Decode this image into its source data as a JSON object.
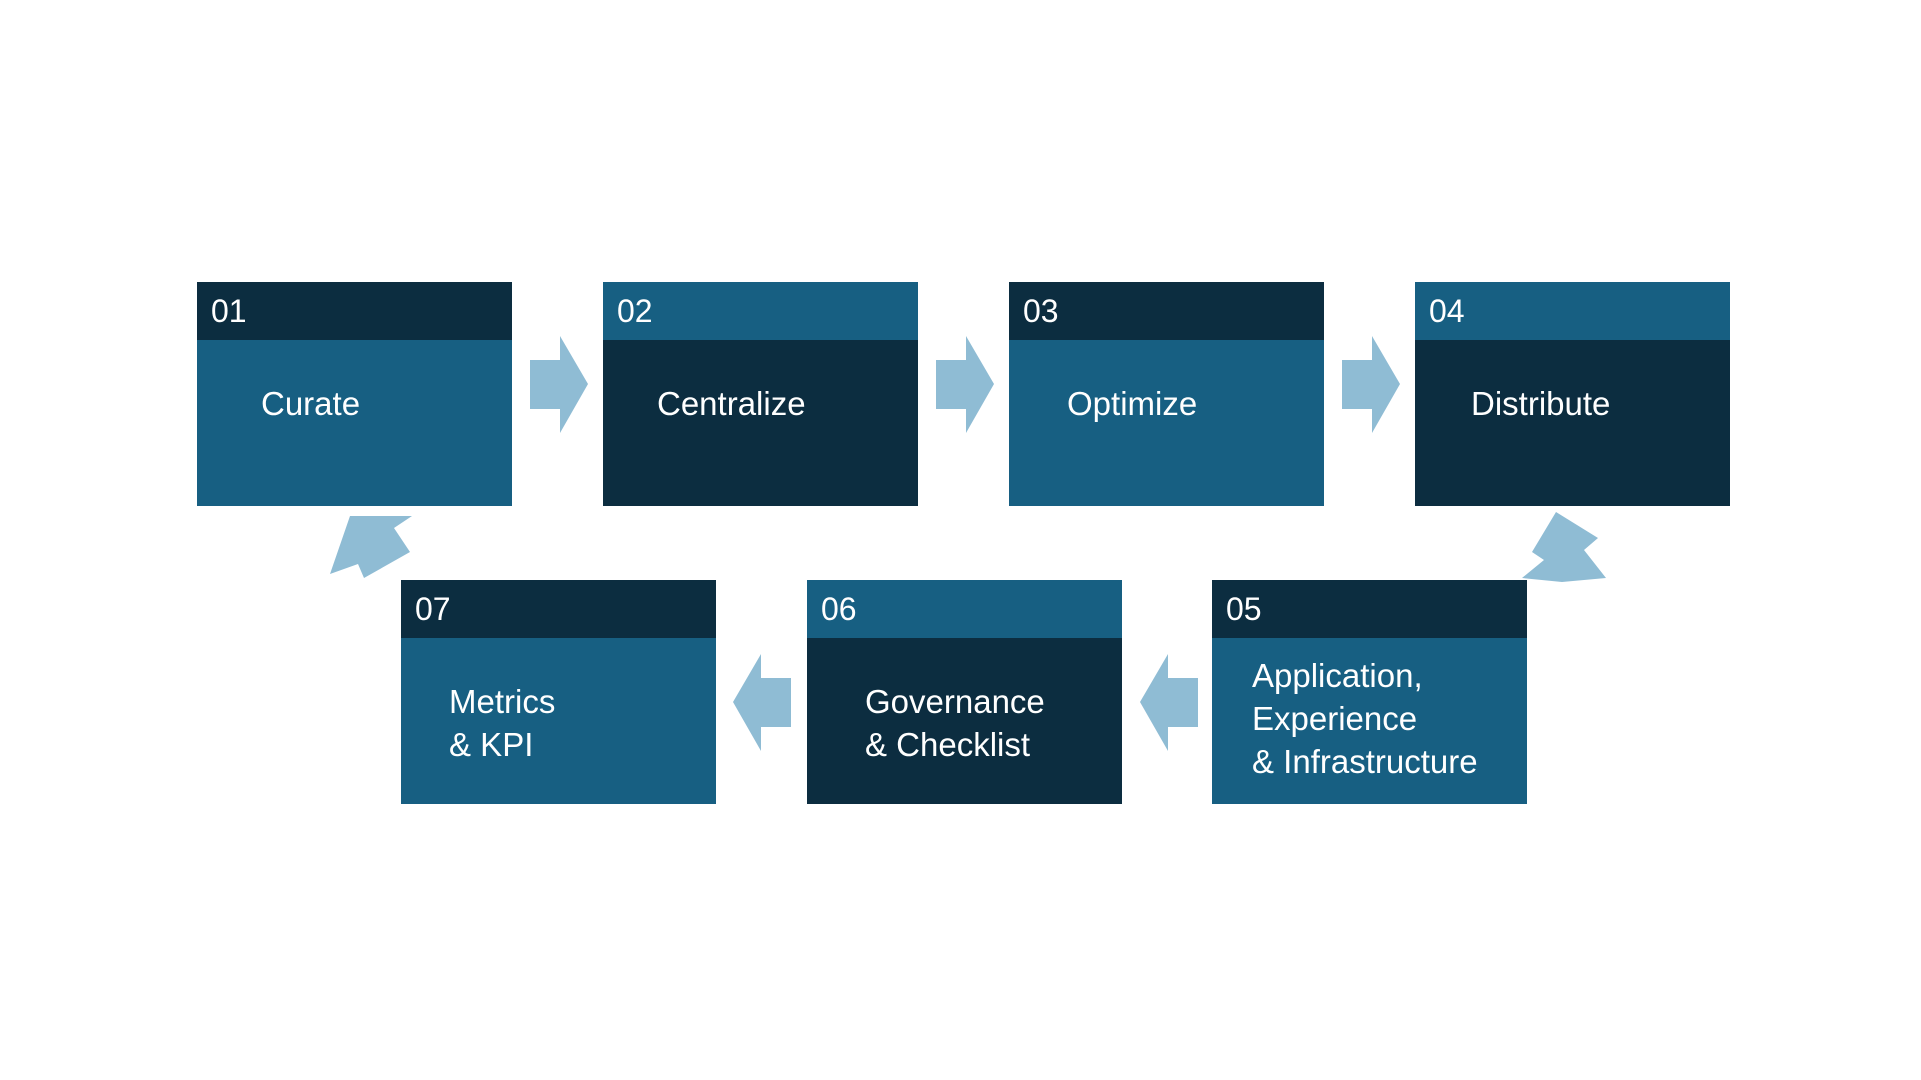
{
  "colors": {
    "dark": "#0c2d40",
    "mid": "#175f82",
    "arrow": "#8fbcd4",
    "text": "#ffffff"
  },
  "steps": [
    {
      "number": "01",
      "label": "Curate"
    },
    {
      "number": "02",
      "label": "Centralize"
    },
    {
      "number": "03",
      "label": "Optimize"
    },
    {
      "number": "04",
      "label": "Distribute"
    },
    {
      "number": "05",
      "label": "Application,\nExperience\n& Infrastructure"
    },
    {
      "number": "06",
      "label": "Governance\n& Checklist"
    },
    {
      "number": "07",
      "label": "Metrics\n& KPI"
    }
  ],
  "arrows": [
    {
      "from": "01",
      "to": "02",
      "direction": "right"
    },
    {
      "from": "02",
      "to": "03",
      "direction": "right"
    },
    {
      "from": "03",
      "to": "04",
      "direction": "right"
    },
    {
      "from": "04",
      "to": "05",
      "direction": "down-left"
    },
    {
      "from": "05",
      "to": "06",
      "direction": "left"
    },
    {
      "from": "06",
      "to": "07",
      "direction": "left"
    },
    {
      "from": "07",
      "to": "01",
      "direction": "up-left"
    }
  ]
}
